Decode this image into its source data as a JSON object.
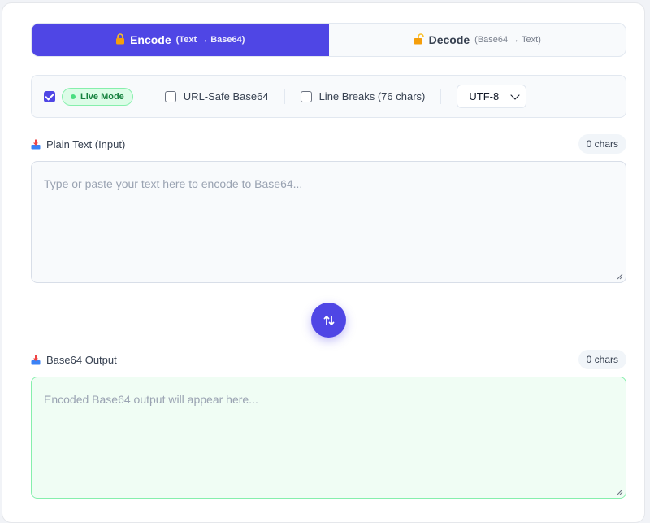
{
  "tabs": [
    {
      "label": "Encode",
      "sub": "(Text → Base64)",
      "icon": "lock-icon",
      "active": true
    },
    {
      "label": "Decode",
      "sub": "(Base64 → Text)",
      "icon": "unlock-icon",
      "active": false
    }
  ],
  "options": {
    "live_mode": {
      "label": "Live Mode",
      "checked": true
    },
    "url_safe": {
      "label": "URL-Safe Base64",
      "checked": false
    },
    "line_breaks": {
      "label": "Line Breaks (76 chars)",
      "checked": false
    },
    "encoding": {
      "selected": "UTF-8"
    }
  },
  "input": {
    "title": "Plain Text (Input)",
    "count": "0 chars",
    "placeholder": "Type or paste your text here to encode to Base64..."
  },
  "output": {
    "title": "Base64 Output",
    "count": "0 chars",
    "placeholder": "Encoded Base64 output will appear here..."
  },
  "colors": {
    "accent": "#4f46e5",
    "live_green": "#15803d",
    "output_bg": "#f0fdf4",
    "output_border": "#86efac"
  }
}
